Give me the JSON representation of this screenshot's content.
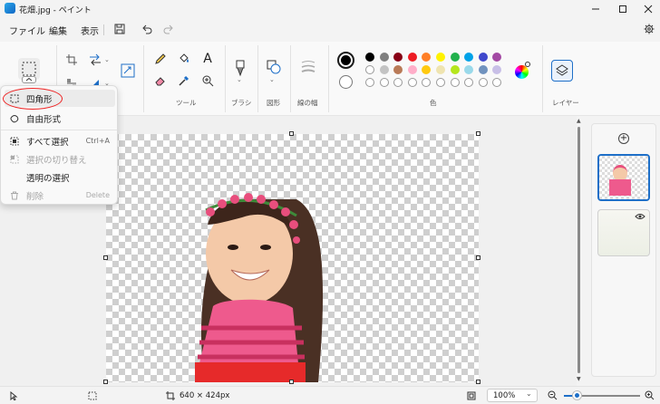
{
  "window": {
    "title": "花畑.jpg - ペイント"
  },
  "menu": {
    "file": "ファイル",
    "edit": "編集",
    "view": "表示"
  },
  "ribbon": {
    "tools_label": "ツール",
    "brush_label": "ブラシ",
    "shapes_label": "図形",
    "stroke_label": "線の幅",
    "colors_label": "色",
    "layers_label": "レイヤー"
  },
  "dropdown": {
    "rect": "四角形",
    "free": "自由形式",
    "select_all": "すべて選択",
    "select_all_shortcut": "Ctrl+A",
    "crop": "選択の切り替え",
    "transparent": "透明の選択",
    "delete": "削除",
    "delete_shortcut": "Delete"
  },
  "palette": {
    "primary": "#000000",
    "secondary": "#ffffff",
    "row1": [
      "#000000",
      "#7f7f7f",
      "#880015",
      "#ed1c24",
      "#ff7f27",
      "#fff200",
      "#22b14c",
      "#00a2e8",
      "#3f48cc",
      "#a349a4"
    ],
    "row2": [
      "#ffffff",
      "#c3c3c3",
      "#b97a57",
      "#ffaec9",
      "#ffc90e",
      "#efe4b0",
      "#b5e61d",
      "#99d9ea",
      "#7092be",
      "#c8bfe7"
    ],
    "row3": [
      "",
      "",
      "",
      "",
      "",
      "",
      "",
      "",
      "",
      ""
    ]
  },
  "status": {
    "size": "640 × 424px",
    "zoom": "100%"
  }
}
